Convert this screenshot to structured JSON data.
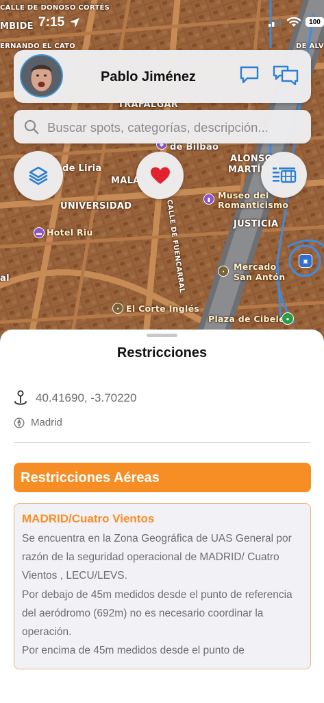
{
  "status_bar": {
    "time": "7:15",
    "battery": "100"
  },
  "map": {
    "labels": {
      "calle_donoso": "CALLE DE DONOSO CORTÉS",
      "bide": "MBIDE",
      "fernando": "ERNANDO EL CATO",
      "street_top_right": "DE ALVO",
      "trafalgar": "TRAFALGAR",
      "bilbao": "de Bilbao",
      "liria": "de Liria",
      "alonso": "ALONSO",
      "martinez": "MARTÍNE",
      "mala": "MALA",
      "universidad": "UNIVERSIDAD",
      "museo": "Museo del",
      "romanticismo": "Romanticismo",
      "justicia": "JUSTICIA",
      "fuencarral": "CALLE DE FUENCARRAL",
      "hotel": "Hotel Riu",
      "mercado": "Mercado",
      "san_anton": "San Antón",
      "al": "al",
      "corte_ingles": "El Corte Inglés",
      "cibeles": "Plaza de Cibeles"
    }
  },
  "header": {
    "user_name": "Pablo Jiménez",
    "chat_icon": "chat-bubble-icon",
    "group_chat_icon": "chat-bubbles-icon"
  },
  "search": {
    "placeholder": "Buscar spots, categorías, descripción..."
  },
  "actions": {
    "layers_icon": "layers-icon",
    "favorite_icon": "heart-icon",
    "list_icon": "list-media-icon"
  },
  "sheet": {
    "title": "Restricciones",
    "coordinates": "40.41690, -3.70220",
    "city": "Madrid",
    "section_title": "Restricciones Aéreas",
    "restriction": {
      "title": "MADRID/Cuatro Vientos",
      "paragraphs": [
        "Se encuentra en la Zona Geográfica de UAS General por razón de la seguridad operacional de MADRID/ Cuatro Vientos , LECU/LEVS.",
        "Por debajo de 45m medidos desde el punto de referencia del aeródromo (692m) no es necesario coordinar la operación.",
        "Por encima de 45m medidos desde el punto de"
      ]
    }
  },
  "colors": {
    "accent": "#f78e25",
    "icon_blue": "#2a7fd4",
    "heart": "#e3222f",
    "map_base": "#8a5430"
  }
}
